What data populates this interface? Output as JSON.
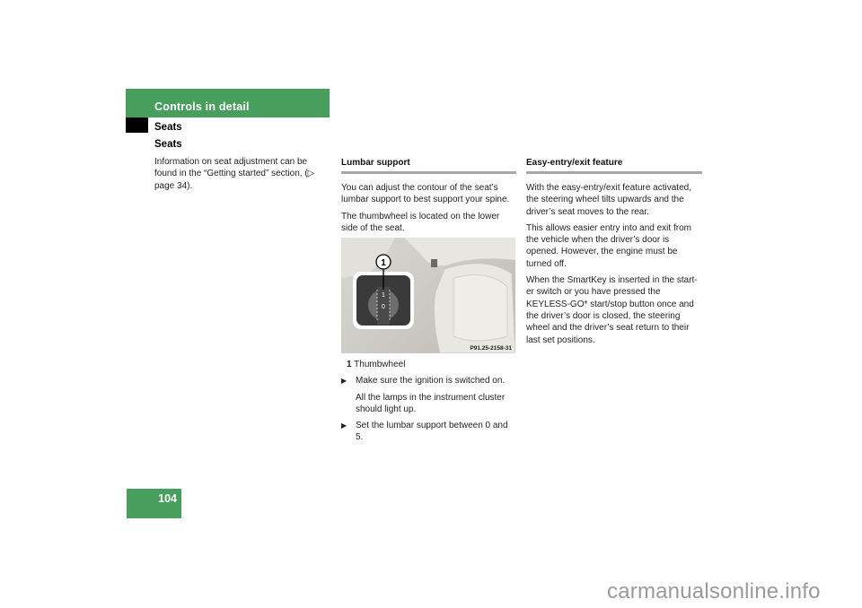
{
  "header": {
    "chapter_title": "Controls in detail",
    "section": "Seats"
  },
  "column1": {
    "heading": "Seats",
    "paragraph": "Information on seat adjustment can be found in the “Getting started” section, (▷ page 34)."
  },
  "column2": {
    "heading": "Lumbar support",
    "paragraphs": [
      "You can adjust the contour of the seat’s lumbar support to best support your spine.",
      "The thumbwheel is located on the lower side of the seat."
    ],
    "figure": {
      "callout_number": "1",
      "dial_labels": [
        "1",
        "0"
      ],
      "figure_code": "P91.25-2158-31"
    },
    "legend": {
      "number": "1",
      "label": "Thumbwheel"
    },
    "steps": [
      {
        "text": "Make sure the ignition is switched on.",
        "note": "All the lamps in the instrument cluster should light up."
      },
      {
        "text": "Set the lumbar support between 0 and 5."
      }
    ],
    "bullet_glyph": "▶"
  },
  "column3": {
    "heading": "Easy-entry/exit feature",
    "paragraphs": [
      "With the easy-entry/exit feature activated, the steering wheel tilts upwards and the driver’s seat moves to the rear.",
      "This allows easier entry into and exit from the vehicle when the driver’s door is opened. However, the engine must be turned off.",
      "When the SmartKey is inserted in the start-er switch or you have pressed the KEYLESS-GO* start/stop button once and the driver’s door is closed, the steering wheel and the driver’s seat return to their last set positions."
    ]
  },
  "footer": {
    "page_number": "104",
    "watermark": "carmanualsonline.info"
  },
  "colors": {
    "accent_green": "#479e5d",
    "rule_gray": "#a8a8a8"
  }
}
